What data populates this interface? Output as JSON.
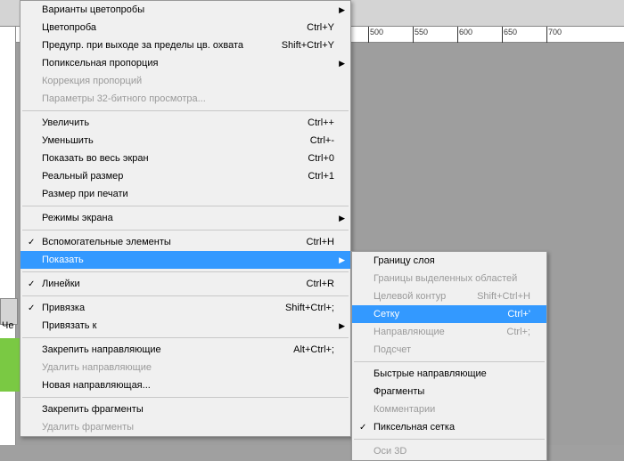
{
  "ruler_ticks": [
    "500",
    "550",
    "600",
    "650",
    "700"
  ],
  "left_label": "Че",
  "menu": [
    {
      "t": "item",
      "label": "Варианты цветопробы",
      "arrow": true
    },
    {
      "t": "item",
      "label": "Цветопроба",
      "shortcut": "Ctrl+Y"
    },
    {
      "t": "item",
      "label": "Предупр. при выходе за пределы цв. охвата",
      "shortcut": "Shift+Ctrl+Y"
    },
    {
      "t": "item",
      "label": "Попиксельная пропорция",
      "arrow": true
    },
    {
      "t": "item",
      "label": "Коррекция пропорций",
      "disabled": true
    },
    {
      "t": "item",
      "label": "Параметры 32-битного просмотра...",
      "disabled": true
    },
    {
      "t": "sep"
    },
    {
      "t": "item",
      "label": "Увеличить",
      "shortcut": "Ctrl++"
    },
    {
      "t": "item",
      "label": "Уменьшить",
      "shortcut": "Ctrl+-"
    },
    {
      "t": "item",
      "label": "Показать во весь экран",
      "shortcut": "Ctrl+0"
    },
    {
      "t": "item",
      "label": "Реальный размер",
      "shortcut": "Ctrl+1"
    },
    {
      "t": "item",
      "label": "Размер при печати"
    },
    {
      "t": "sep"
    },
    {
      "t": "item",
      "label": "Режимы экрана",
      "arrow": true
    },
    {
      "t": "sep"
    },
    {
      "t": "item",
      "label": "Вспомогательные элементы",
      "shortcut": "Ctrl+H",
      "check": true
    },
    {
      "t": "item",
      "label": "Показать",
      "arrow": true,
      "highlight": true
    },
    {
      "t": "sep"
    },
    {
      "t": "item",
      "label": "Линейки",
      "shortcut": "Ctrl+R",
      "check": true
    },
    {
      "t": "sep"
    },
    {
      "t": "item",
      "label": "Привязка",
      "shortcut": "Shift+Ctrl+;",
      "check": true
    },
    {
      "t": "item",
      "label": "Привязать к",
      "arrow": true
    },
    {
      "t": "sep"
    },
    {
      "t": "item",
      "label": "Закрепить направляющие",
      "shortcut": "Alt+Ctrl+;"
    },
    {
      "t": "item",
      "label": "Удалить направляющие",
      "disabled": true
    },
    {
      "t": "item",
      "label": "Новая направляющая..."
    },
    {
      "t": "sep"
    },
    {
      "t": "item",
      "label": "Закрепить фрагменты"
    },
    {
      "t": "item",
      "label": "Удалить фрагменты",
      "disabled": true
    }
  ],
  "submenu": [
    {
      "t": "item",
      "label": "Границу слоя"
    },
    {
      "t": "item",
      "label": "Границы выделенных областей",
      "disabled": true
    },
    {
      "t": "item",
      "label": "Целевой контур",
      "shortcut": "Shift+Ctrl+H",
      "disabled": true
    },
    {
      "t": "item",
      "label": "Сетку",
      "shortcut": "Ctrl+'",
      "highlight": true
    },
    {
      "t": "item",
      "label": "Направляющие",
      "shortcut": "Ctrl+;",
      "disabled": true
    },
    {
      "t": "item",
      "label": "Подсчет",
      "disabled": true
    },
    {
      "t": "sep"
    },
    {
      "t": "item",
      "label": "Быстрые направляющие"
    },
    {
      "t": "item",
      "label": "Фрагменты"
    },
    {
      "t": "item",
      "label": "Комментарии",
      "disabled": true
    },
    {
      "t": "item",
      "label": "Пиксельная сетка",
      "check": true
    },
    {
      "t": "sep"
    },
    {
      "t": "item",
      "label": "Оси 3D",
      "disabled": true
    }
  ]
}
